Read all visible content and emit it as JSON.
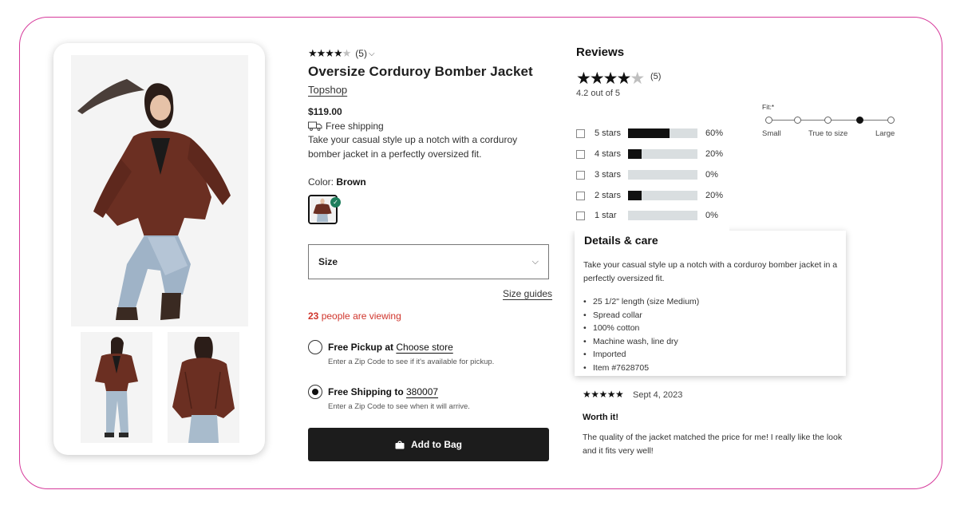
{
  "product": {
    "rating_stars": 4.2,
    "review_count": "(5)",
    "title": "Oversize Corduroy Bomber Jacket",
    "brand": "Topshop",
    "price": "$119.00",
    "shipping": "Free shipping",
    "description": "Take your casual style up a notch with a corduroy bomber jacket in a perfectly oversized fit.",
    "color_label": "Color:",
    "color_value": "Brown",
    "size_label": "Size",
    "size_guides": "Size guides",
    "viewing_count": "23",
    "viewing_text": " people are viewing",
    "pickup": {
      "title": "Free Pickup at ",
      "link": "Choose store",
      "sub": "Enter a Zip Code to see if it's available for pickup.",
      "selected": false
    },
    "ship_option": {
      "title": "Free Shipping to ",
      "link": "380007",
      "sub": "Enter a Zip Code to see when it will arrive.",
      "selected": true
    },
    "add_to_bag": "Add to Bag"
  },
  "reviews": {
    "title": "Reviews",
    "count": "(5)",
    "average_text": "4.2 out of 5",
    "breakdown": [
      {
        "label": "5 stars",
        "percent": 60,
        "percent_text": "60%"
      },
      {
        "label": "4 stars",
        "percent": 20,
        "percent_text": "20%"
      },
      {
        "label": "3 stars",
        "percent": 0,
        "percent_text": "0%"
      },
      {
        "label": "2 stars",
        "percent": 20,
        "percent_text": "20%"
      },
      {
        "label": "1 star",
        "percent": 0,
        "percent_text": "0%"
      }
    ],
    "fit": {
      "label": "Fit:*",
      "options": [
        "Small",
        "True to size",
        "Large"
      ],
      "selected_step": 4,
      "step_count": 5
    },
    "details": {
      "title": "Details & care",
      "description": "Take your casual style up a notch with a corduroy bomber jacket in a perfectly oversized fit.",
      "items": [
        "25 1/2\" length (size Medium)",
        "Spread collar",
        "100% cotton",
        "Machine wash, line dry",
        "Imported",
        "Item #7628705"
      ]
    },
    "review": {
      "stars": "★★★★★",
      "date": "Sept 4, 2023",
      "title": "Worth it!",
      "body": "The quality of the jacket matched the price for me! I really like the look and it fits very well!"
    }
  },
  "icons": {
    "star_full": "★",
    "star_empty": "★",
    "chevron": "⌵",
    "check": "✓"
  },
  "colors": {
    "frame_border": "#d63a9b",
    "jacket": "#6b2f22",
    "viewing_red": "#d0352c",
    "check_green": "#1e7e5c",
    "button_dark": "#1c1c1c"
  }
}
